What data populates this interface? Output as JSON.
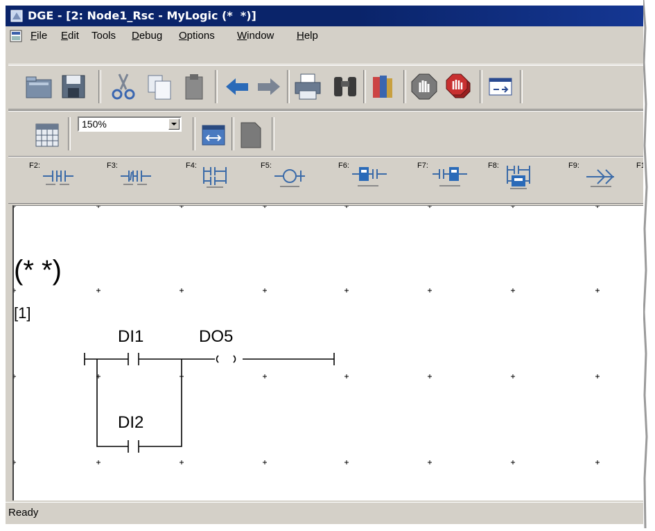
{
  "window": {
    "title": "DGE - [2: Node1_Rsc - MyLogic (*  *)]"
  },
  "menu": {
    "items": [
      {
        "label": "File",
        "accel": "F",
        "rest": "ile"
      },
      {
        "label": "Edit",
        "accel": "E",
        "rest": "dit"
      },
      {
        "label": "Tools",
        "accel": "",
        "rest": "Tools"
      },
      {
        "label": "Debug",
        "accel": "D",
        "rest": "ebug"
      },
      {
        "label": "Options",
        "accel": "O",
        "rest": "ptions"
      },
      {
        "label": "Window",
        "accel": "W",
        "rest": "indow"
      },
      {
        "label": "Help",
        "accel": "H",
        "rest": "elp"
      }
    ]
  },
  "toolbar_main": {
    "buttons": [
      "open-icon",
      "save-icon",
      "cut-icon",
      "copy-icon",
      "paste-icon",
      "undo-icon",
      "redo-icon",
      "print-icon",
      "find-icon",
      "library-icon",
      "stop-icon",
      "stop-all-icon",
      "module-icon"
    ]
  },
  "toolbar_view": {
    "zoom_value": "150%"
  },
  "toolbar_ladder": {
    "keys": [
      {
        "key": "F2:",
        "icon": "contact-open-icon"
      },
      {
        "key": "F3:",
        "icon": "contact-closed-icon"
      },
      {
        "key": "F4:",
        "icon": "parallel-branch-icon"
      },
      {
        "key": "F5:",
        "icon": "coil-icon"
      },
      {
        "key": "F6:",
        "icon": "function-block-left-icon"
      },
      {
        "key": "F7:",
        "icon": "function-block-right-icon"
      },
      {
        "key": "F8:",
        "icon": "function-block-parallel-icon"
      },
      {
        "key": "F9:",
        "icon": "jump-icon"
      },
      {
        "key": "F1",
        "icon": "more-icon"
      }
    ]
  },
  "diagram": {
    "comment": "(*   *)",
    "rung_number": "[1]",
    "contact1": "DI1",
    "coil1": "DO5",
    "contact2": "DI2"
  },
  "status": {
    "text": "Ready"
  }
}
